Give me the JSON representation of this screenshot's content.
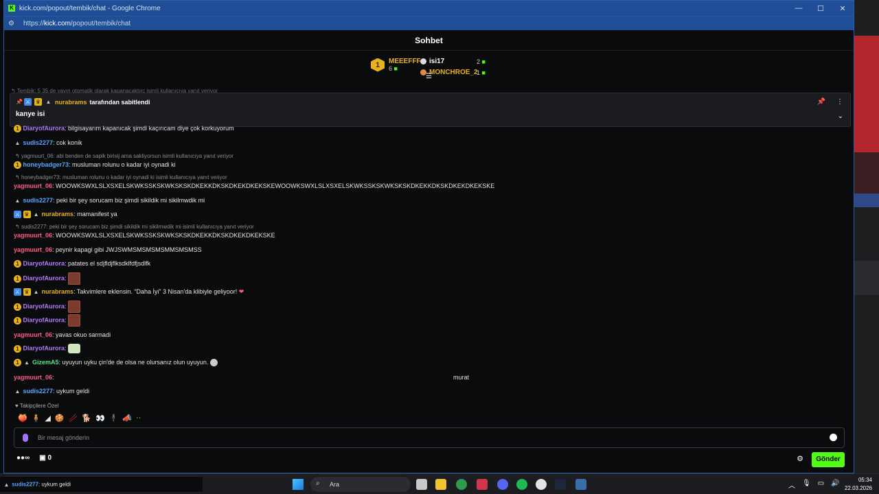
{
  "window": {
    "title": "kick.com/popout/tembik/chat - Google Chrome",
    "url_prefix": "https://",
    "url_host": "kick.com",
    "url_path": "/popout/tembik/chat"
  },
  "chat": {
    "header": "Sohbet",
    "leaderboard": {
      "first": {
        "rank": "1",
        "name": "MEEEFFF",
        "count": "6"
      },
      "second": {
        "name": "isi17",
        "count": "2"
      },
      "third": {
        "name": "MONCHROE_2",
        "count": "1"
      }
    },
    "ghost_reply": "Tembik: 5 35 de yayın otomatik olarak kapanacaktırç isimli kullanıcıya yanıt veriyor",
    "pinned": {
      "user": "nurabrams",
      "by_text": " tarafından sabitlendi",
      "message": "kanye isi"
    },
    "messages": [
      {
        "user": "DiaryofAurora",
        "text": ": bilgisayarım kapanıcak şimdi kaçırıcam diye çok korkuyorum"
      },
      {
        "user": "sudis2277",
        "text": ": cok konik"
      },
      {
        "reply": "yagmuurt_06: abi benden de sapik birisij ama sakliyorsun isimli kullanıcıya yanıt veriyor"
      },
      {
        "user": "honeybadger73",
        "text": ": musluman rolunu o kadar iyi oynadi ki"
      },
      {
        "reply": "honeybadger73: musluman rolunu o kadar iyi oynadi ki isimli kullanıcıya yanıt veriyor"
      },
      {
        "user": "yagmuurt_06",
        "text": ": WOOWKSWXLSLXSXELSKWKSSKSKWKSKSKDKEKKDKSKDKEKDKEKSKEWOOWKSWXLSLXSXELSKWKSSKSKWKSKSKDKEKKDKSKDKEKDKEKSKE"
      },
      {
        "user": "sudis2277",
        "text": ": peki bir şey sorucam biz şimdi sikildik mi sikilmwdik mi"
      },
      {
        "user": "nurabrams",
        "text": ": mamanifest ya"
      },
      {
        "reply": "sudis2277: peki bir şey sorucam biz şimdi sikildik mi sikilmwdik mi isimli kullanıcıya yanıt veriyor"
      },
      {
        "user": "yagmuurt_06",
        "text": ": WOOWKSWXLSLXSXELSKWKSSKSKWKSKSKDKEKKDKSKDKEKDKEKSKE"
      },
      {
        "user": "yagmuurt_06",
        "text": ": peynir kapagi gibi JWJSWMSMSMSMSMMSMSMSS"
      },
      {
        "user": "DiaryofAurora",
        "text": ": patates el sdjfldjflksdklfdfjsdlfk"
      },
      {
        "user": "DiaryofAurora",
        "text": ":"
      },
      {
        "user": "nurabrams",
        "text": ": Takvimlere eklensin. “Daha İyi” 3 Nisan'da klibiyle geliyoor!"
      },
      {
        "user": "DiaryofAurora",
        "text": ":"
      },
      {
        "user": "DiaryofAurora",
        "text": ":"
      },
      {
        "user": "yagmuurt_06",
        "text": ": yavas okuo sarmadi"
      },
      {
        "user": "DiaryofAurora",
        "text": ":"
      },
      {
        "user": "GizemA5",
        "text": ": uyuyun uyku çin'de de olsa ne olursanız olun uyuyun."
      },
      {
        "user": "yagmuurt_06",
        "text": ":",
        "extra": "murat"
      },
      {
        "user": "sudis2277",
        "text": ": uykum geldi"
      }
    ],
    "emote_bar_label": "Takipçilere Özel",
    "input_placeholder": "Bir mesaj gönderin",
    "footer": {
      "infinity": "∞",
      "gift_count": "0",
      "send_label": "Gönder"
    }
  },
  "taskbar": {
    "preview_user": "sudis2277",
    "preview_text": ": uykum geldi",
    "search_label": "Ara",
    "time": "05:34",
    "date": "22.03.2026"
  }
}
